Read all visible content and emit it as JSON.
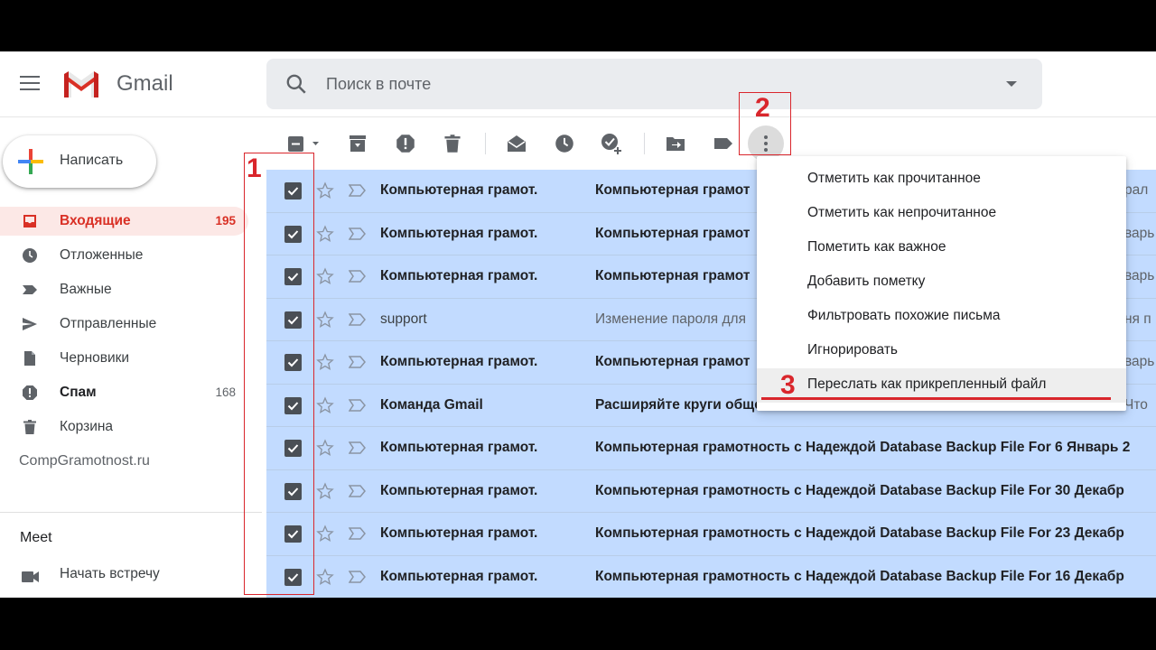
{
  "app": {
    "name": "Gmail"
  },
  "search": {
    "placeholder": "Поиск в почте"
  },
  "sidebar": {
    "compose_label": "Написать",
    "items": [
      {
        "label": "Входящие",
        "count": "195",
        "icon": "inbox-icon",
        "active": true
      },
      {
        "label": "Отложенные",
        "count": "",
        "icon": "clock-icon"
      },
      {
        "label": "Важные",
        "count": "",
        "icon": "important-icon"
      },
      {
        "label": "Отправленные",
        "count": "",
        "icon": "send-icon"
      },
      {
        "label": "Черновики",
        "count": "",
        "icon": "draft-icon"
      },
      {
        "label": "Спам",
        "count": "168",
        "icon": "spam-icon",
        "bold": true
      },
      {
        "label": "Корзина",
        "count": "",
        "icon": "trash-icon"
      }
    ],
    "site_label": "CompGramotnost.ru",
    "meet_title": "Meet",
    "meet_item": "Начать встречу"
  },
  "toolbar": {
    "icons": [
      "select-all-icon",
      "archive-icon",
      "report-spam-icon",
      "delete-icon",
      "mark-read-icon",
      "snooze-icon",
      "add-task-icon",
      "move-to-icon",
      "label-icon",
      "more-icon"
    ]
  },
  "emails": [
    {
      "sender": "Компьютерная грамот.",
      "subject": "Компьютерная грамот",
      "snippet": "рал",
      "unread": true
    },
    {
      "sender": "Компьютерная грамот.",
      "subject": "Компьютерная грамот",
      "snippet": "варь",
      "unread": true
    },
    {
      "sender": "Компьютерная грамот.",
      "subject": "Компьютерная грамот",
      "snippet": "варь",
      "unread": true
    },
    {
      "sender": "support",
      "subject": "Изменение пароля для",
      "snippet": "ня п",
      "unread": false
    },
    {
      "sender": "Компьютерная грамот.",
      "subject": "Компьютерная грамот",
      "snippet": "варь",
      "unread": true
    },
    {
      "sender": "Команда Gmail",
      "subject": "Расширяйте круги общения с Gmail",
      "snippet": "Что",
      "unread": true
    },
    {
      "sender": "Компьютерная грамот.",
      "subject": "Компьютерная грамотность с Надеждой Database Backup File For 6 Январь 2",
      "snippet": "",
      "unread": true
    },
    {
      "sender": "Компьютерная грамот.",
      "subject": "Компьютерная грамотность с Надеждой Database Backup File For 30 Декабр",
      "snippet": "",
      "unread": true
    },
    {
      "sender": "Компьютерная грамот.",
      "subject": "Компьютерная грамотность с Надеждой Database Backup File For 23 Декабр",
      "snippet": "",
      "unread": true
    },
    {
      "sender": "Компьютерная грамот.",
      "subject": "Компьютерная грамотность с Надеждой Database Backup File For 16 Декабр",
      "snippet": "",
      "unread": true
    }
  ],
  "menu": {
    "items": [
      "Отметить как прочитанное",
      "Отметить как непрочитанное",
      "Пометить как важное",
      "Добавить пометку",
      "Фильтровать похожие письма",
      "Игнорировать",
      "Переслать как прикрепленный файл"
    ]
  },
  "annotations": {
    "n1": "1",
    "n2": "2",
    "n3": "3",
    "color": "#d9262c"
  },
  "colors": {
    "accent": "#d93025",
    "selected_row": "#c2dbff"
  }
}
